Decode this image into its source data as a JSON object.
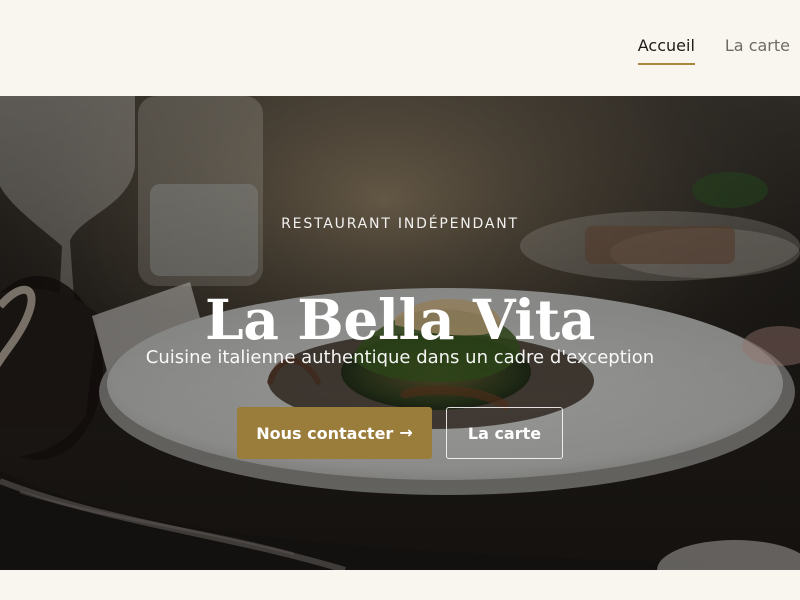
{
  "header": {
    "nav": [
      {
        "label": "Accueil",
        "active": true
      },
      {
        "label": "La carte",
        "active": false
      }
    ]
  },
  "hero": {
    "eyebrow": "RESTAURANT INDÉPENDANT",
    "title": "La Bella Vita",
    "subtitle": "Cuisine italienne authentique dans un cadre d'exception",
    "primary_button": {
      "label": "Nous contacter",
      "icon": "arrow-right-icon",
      "icon_glyph": "→"
    },
    "secondary_button": {
      "label": "La carte"
    }
  },
  "colors": {
    "accent": "#9b7d3b",
    "background": "#f9f6f0",
    "hero_text": "#ffffff"
  }
}
